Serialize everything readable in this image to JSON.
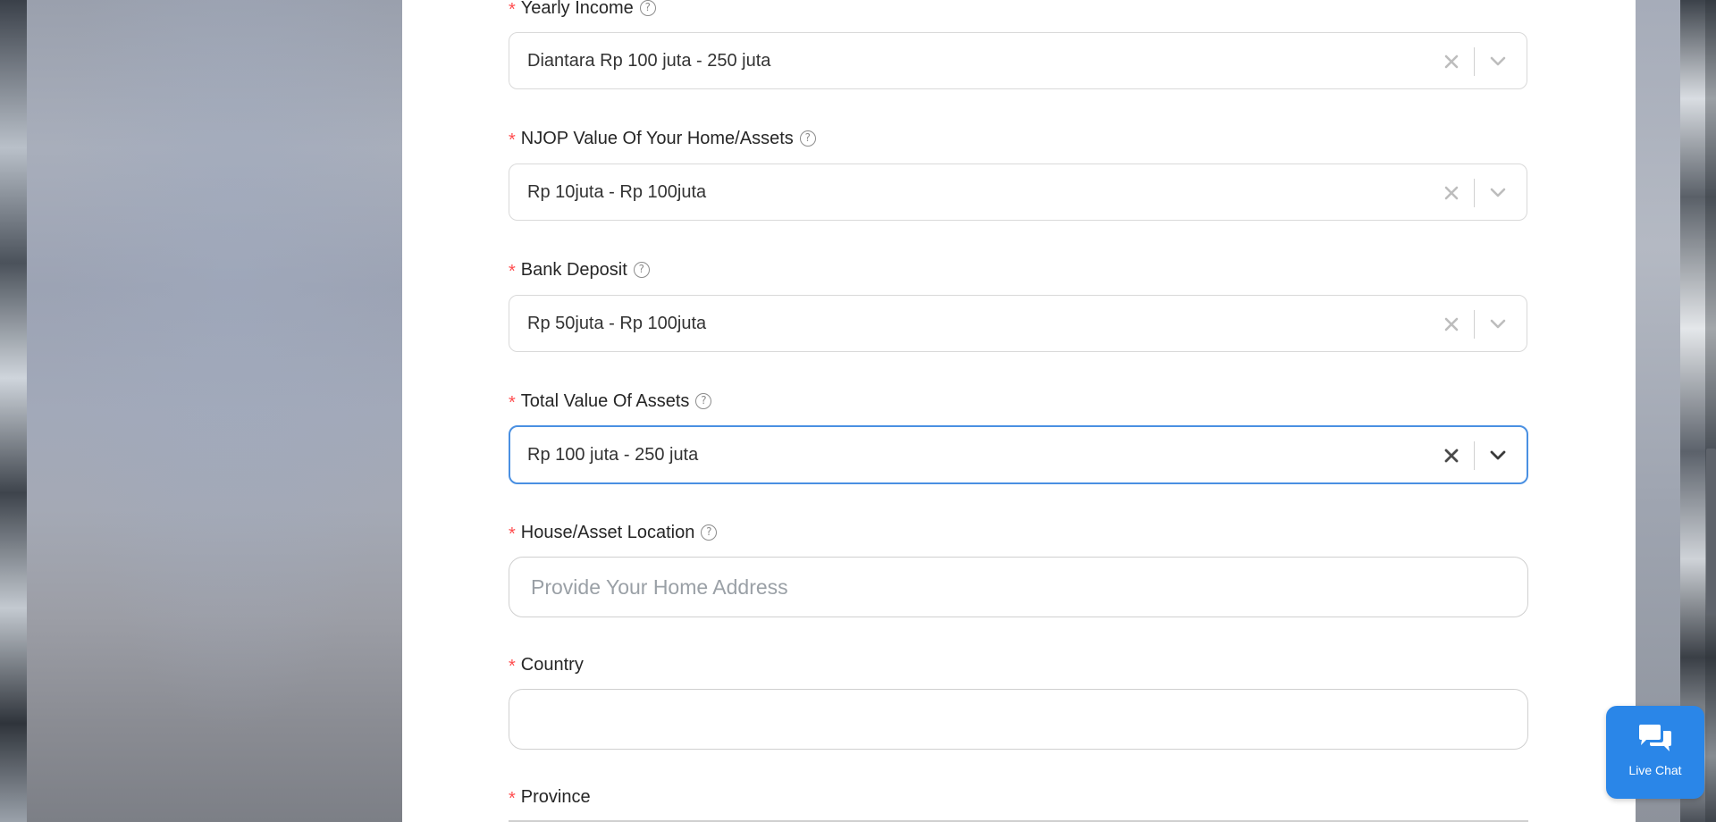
{
  "form": {
    "fields": [
      {
        "label": "Yearly Income",
        "value": "Diantara Rp 100 juta - 250 juta",
        "required": "*"
      },
      {
        "label": "NJOP Value Of Your Home/Assets",
        "value": "Rp 10juta - Rp 100juta",
        "required": "*"
      },
      {
        "label": "Bank Deposit",
        "value": "Rp 50juta - Rp 100juta",
        "required": "*"
      },
      {
        "label": "Total Value Of Assets",
        "value": "Rp 100 juta - 250 juta",
        "required": "*"
      },
      {
        "label": "House/Asset Location",
        "placeholder": "Provide Your Home Address",
        "required": "*"
      },
      {
        "label": "Country",
        "value": "",
        "required": "*"
      },
      {
        "label": "Province",
        "required": "*"
      }
    ],
    "help_glyph": "?"
  },
  "live_chat": {
    "label": "Live Chat"
  },
  "colors": {
    "accent": "#4a90e2",
    "required": "#ff4d4f",
    "chat_button": "#2a86e8"
  },
  "icons": [
    "help-icon",
    "clear-icon",
    "chevron-down-icon",
    "chat-bubbles-icon"
  ]
}
